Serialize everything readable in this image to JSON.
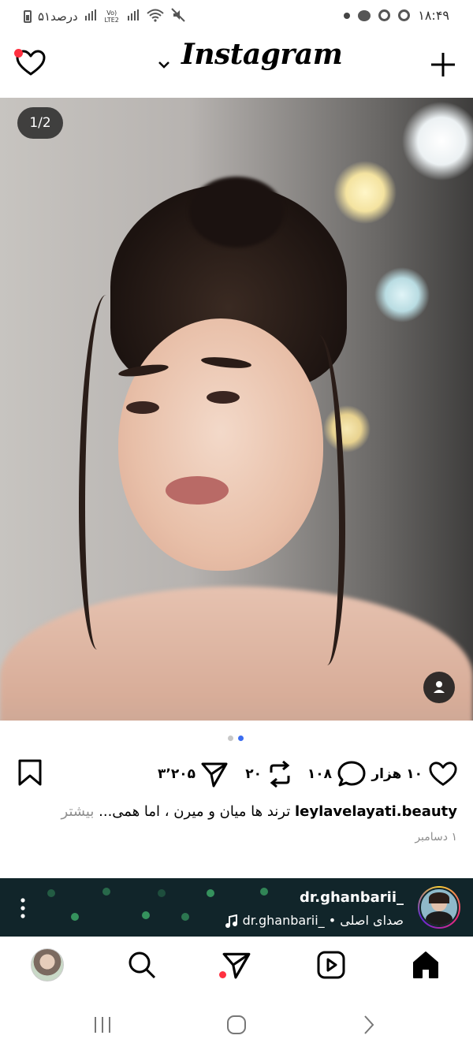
{
  "status_bar": {
    "battery_text": "۵۱درصد",
    "volte_text": "Vo) LTE2",
    "time": "۱۸:۴۹"
  },
  "header": {
    "logo_text": "Instagram"
  },
  "post": {
    "page_indicator": "1/2",
    "carousel": {
      "total": 2,
      "active_index": 1
    },
    "likes": "۱۰ هزار",
    "comments": "۱۰۸",
    "reposts": "۲۰",
    "shares": "۳٬۲۰۵",
    "caption_username": "leylavelayati.beauty",
    "caption_text": "ترند ها میان و میرن ، اما همی...",
    "caption_more": "بیشتر",
    "date": "۱ دسامبر"
  },
  "next_post": {
    "username": "dr.ghanbarii_",
    "audio_label": "صدای اصلی",
    "audio_user": "dr.ghanbarii_",
    "separator": "•"
  },
  "icons": {
    "activity": "heart-icon",
    "new_post": "plus-icon",
    "like": "heart-icon",
    "comment": "comment-icon",
    "repost": "repost-icon",
    "share": "send-icon",
    "save": "bookmark-icon"
  },
  "colors": {
    "accent_blue": "#3b6cf0",
    "notification_red": "#ff3040",
    "next_post_bg": "#11252a"
  }
}
